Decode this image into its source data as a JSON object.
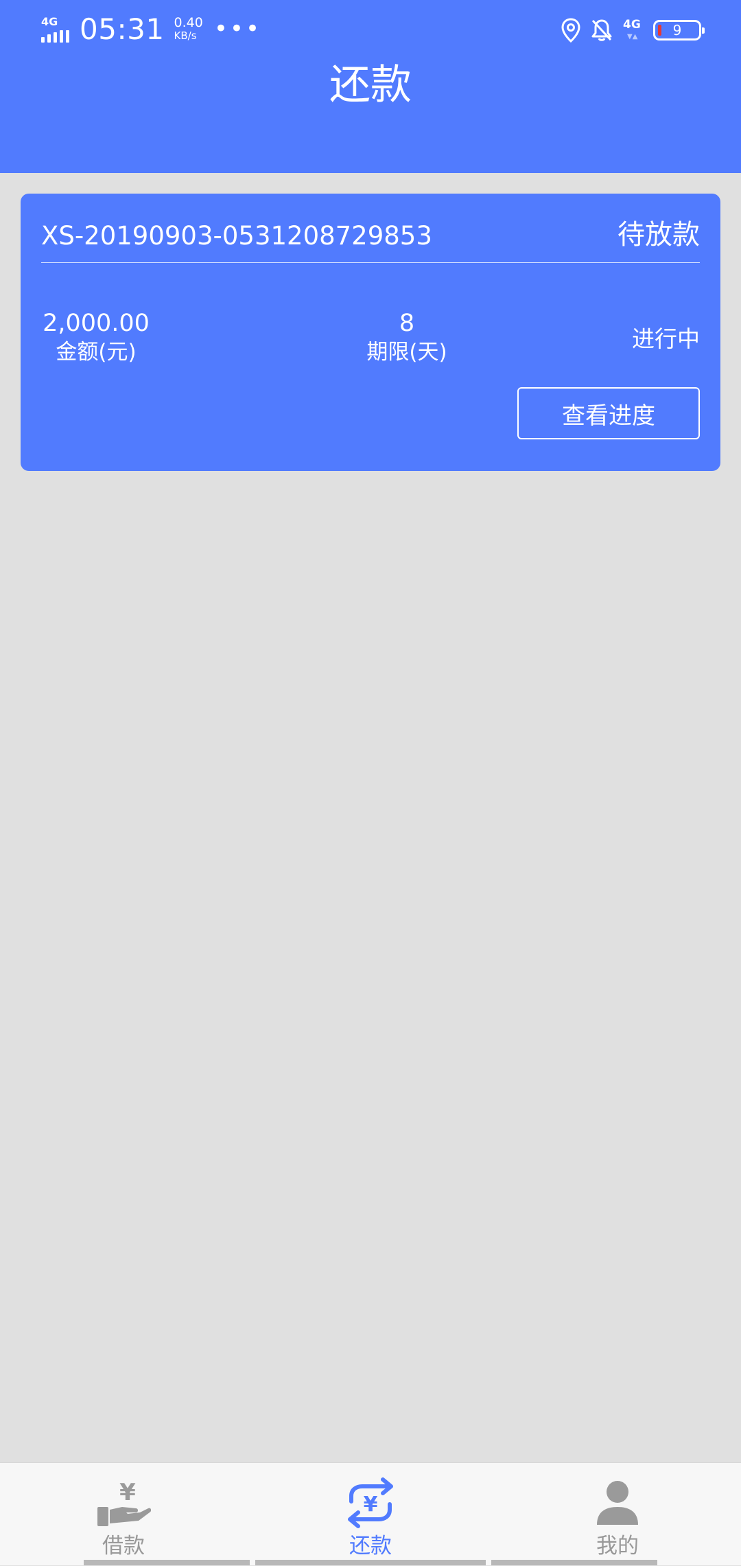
{
  "status_bar": {
    "network_left": "4G",
    "time": "05:31",
    "speed_value": "0.40",
    "speed_unit": "KB/s",
    "network_right": "4G",
    "battery_level": "9"
  },
  "header": {
    "title": "还款"
  },
  "loan_card": {
    "order_no": "XS-20190903-0531208729853",
    "order_status": "待放款",
    "amount_value": "2,000.00",
    "amount_label": "金额(元)",
    "term_value": "8",
    "term_label": "期限(天)",
    "progress_status": "进行中",
    "view_progress_button": "查看进度"
  },
  "tabbar": {
    "active_tab": "还款",
    "tabs": [
      {
        "label": "借款",
        "icon": "hand-yen-icon"
      },
      {
        "label": "还款",
        "icon": "repay-cycle-icon"
      },
      {
        "label": "我的",
        "icon": "user-icon"
      }
    ]
  },
  "colors": {
    "primary": "#517bfe",
    "background": "#e0e0e0",
    "tabbar_bg": "#f7f7f7",
    "tab_inactive": "#999999",
    "battery_low": "#e53935"
  }
}
